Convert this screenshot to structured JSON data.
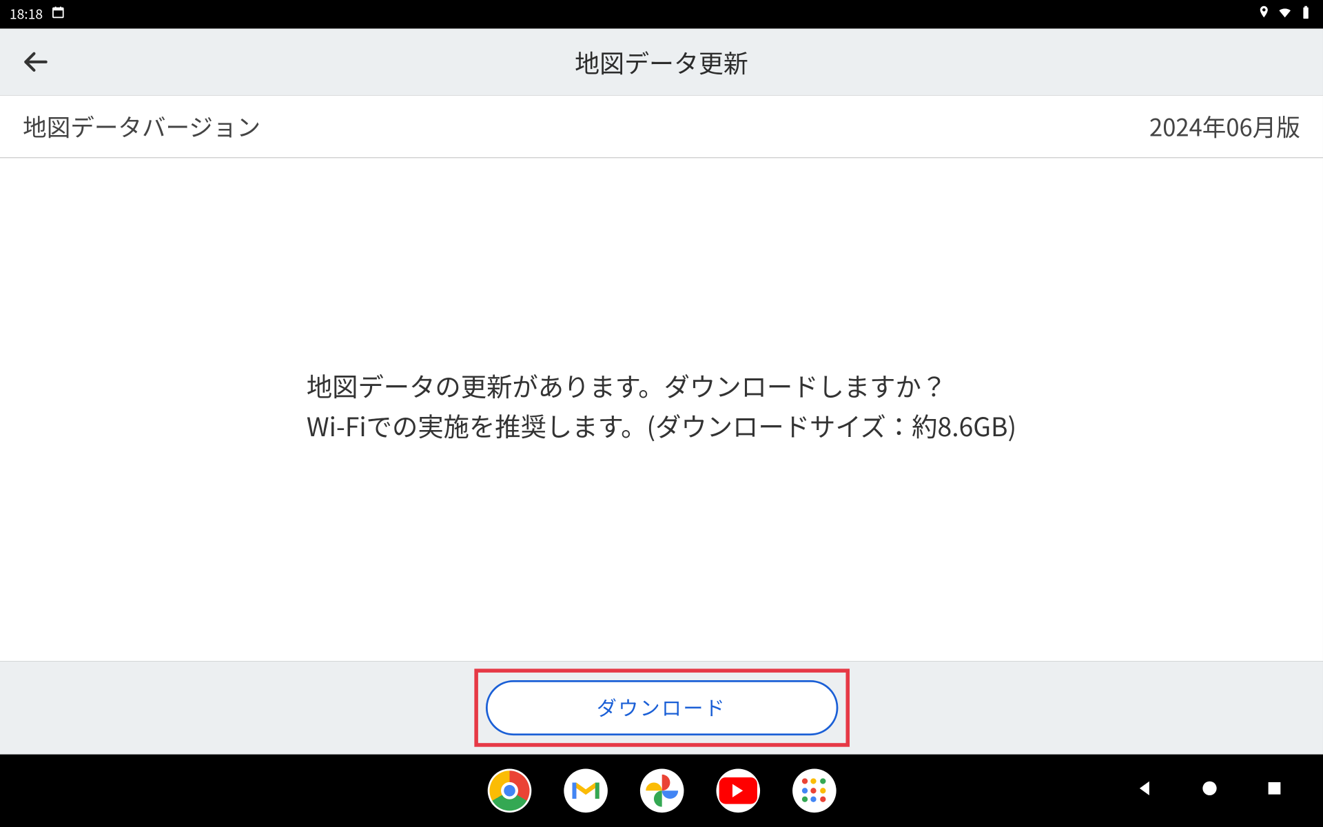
{
  "statusbar": {
    "time": "18:18",
    "icons": {
      "calendar": "calendar-icon",
      "location": "location-icon",
      "wifi": "wifi-icon",
      "battery": "battery-icon"
    }
  },
  "header": {
    "title": "地図データ更新",
    "back_label": "back"
  },
  "version_row": {
    "label": "地図データバージョン",
    "value": "2024年06月版"
  },
  "main": {
    "line1": "地図データの更新があります。ダウンロードしますか？",
    "line2": "Wi-Fiでの実施を推奨します。(ダウンロードサイズ：約8.6GB)"
  },
  "download": {
    "button_label": "ダウンロード"
  },
  "navbar": {
    "apps": [
      "chrome",
      "gmail",
      "photos",
      "youtube",
      "apps"
    ],
    "controls": [
      "nav-back",
      "nav-home",
      "nav-recent"
    ]
  },
  "colors": {
    "accent": "#1a5fd6",
    "highlight": "#e63946",
    "appbar_bg": "#eceff1"
  }
}
